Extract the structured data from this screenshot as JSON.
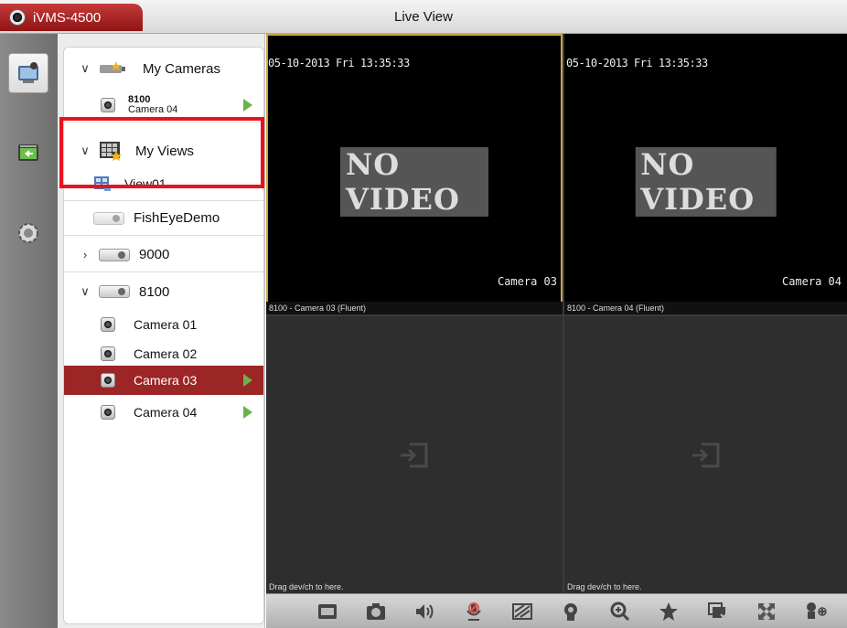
{
  "app": {
    "name": "iVMS-4500",
    "page_title": "Live View"
  },
  "rail": {
    "items": [
      {
        "icon": "live-view-icon",
        "active": true
      },
      {
        "icon": "playback-icon",
        "active": false
      },
      {
        "icon": "settings-gear-icon",
        "active": false
      }
    ]
  },
  "tree": {
    "my_cameras": {
      "label": "My Cameras",
      "expanded": true
    },
    "my_cameras_item": {
      "device": "8100",
      "camera": "Camera 04"
    },
    "my_views": {
      "label": "My Views",
      "expanded": true
    },
    "view01": {
      "label": "View01"
    },
    "fisheye": {
      "label": "FishEyeDemo"
    },
    "dev9000": {
      "label": "9000",
      "expanded": false
    },
    "dev8100": {
      "label": "8100",
      "expanded": true
    },
    "cameras": [
      {
        "label": "Camera 01",
        "playing": false,
        "selected": false
      },
      {
        "label": "Camera 02",
        "playing": false,
        "selected": false
      },
      {
        "label": "Camera 03",
        "playing": true,
        "selected": true
      },
      {
        "label": "Camera 04",
        "playing": true,
        "selected": false
      }
    ]
  },
  "video": {
    "cells": [
      {
        "timestamp": "05-10-2013 Fri 13:35:33",
        "message": "NO VIDEO",
        "osd_camera": "Camera 03",
        "caption": "8100 - Camera 03 (Fluent)"
      },
      {
        "timestamp": "05-10-2013 Fri 13:35:33",
        "message": "NO VIDEO",
        "osd_camera": "Camera 04",
        "caption": "8100 - Camera 04 (Fluent)"
      },
      {
        "caption": "Drag dev/ch to here."
      },
      {
        "caption": "Drag dev/ch to here."
      }
    ]
  },
  "toolbar": {
    "tools": [
      "record-icon",
      "snapshot-icon",
      "audio-icon",
      "talk-mute-icon",
      "image-quality-icon",
      "ptz-icon",
      "digital-zoom-icon",
      "favorite-star-icon",
      "stop-all-icon",
      "fullscreen-icon",
      "ptz-preset-icon"
    ]
  },
  "colors": {
    "accent": "#9c2525",
    "highlight": "#e8141d",
    "play": "#6ab34b"
  }
}
